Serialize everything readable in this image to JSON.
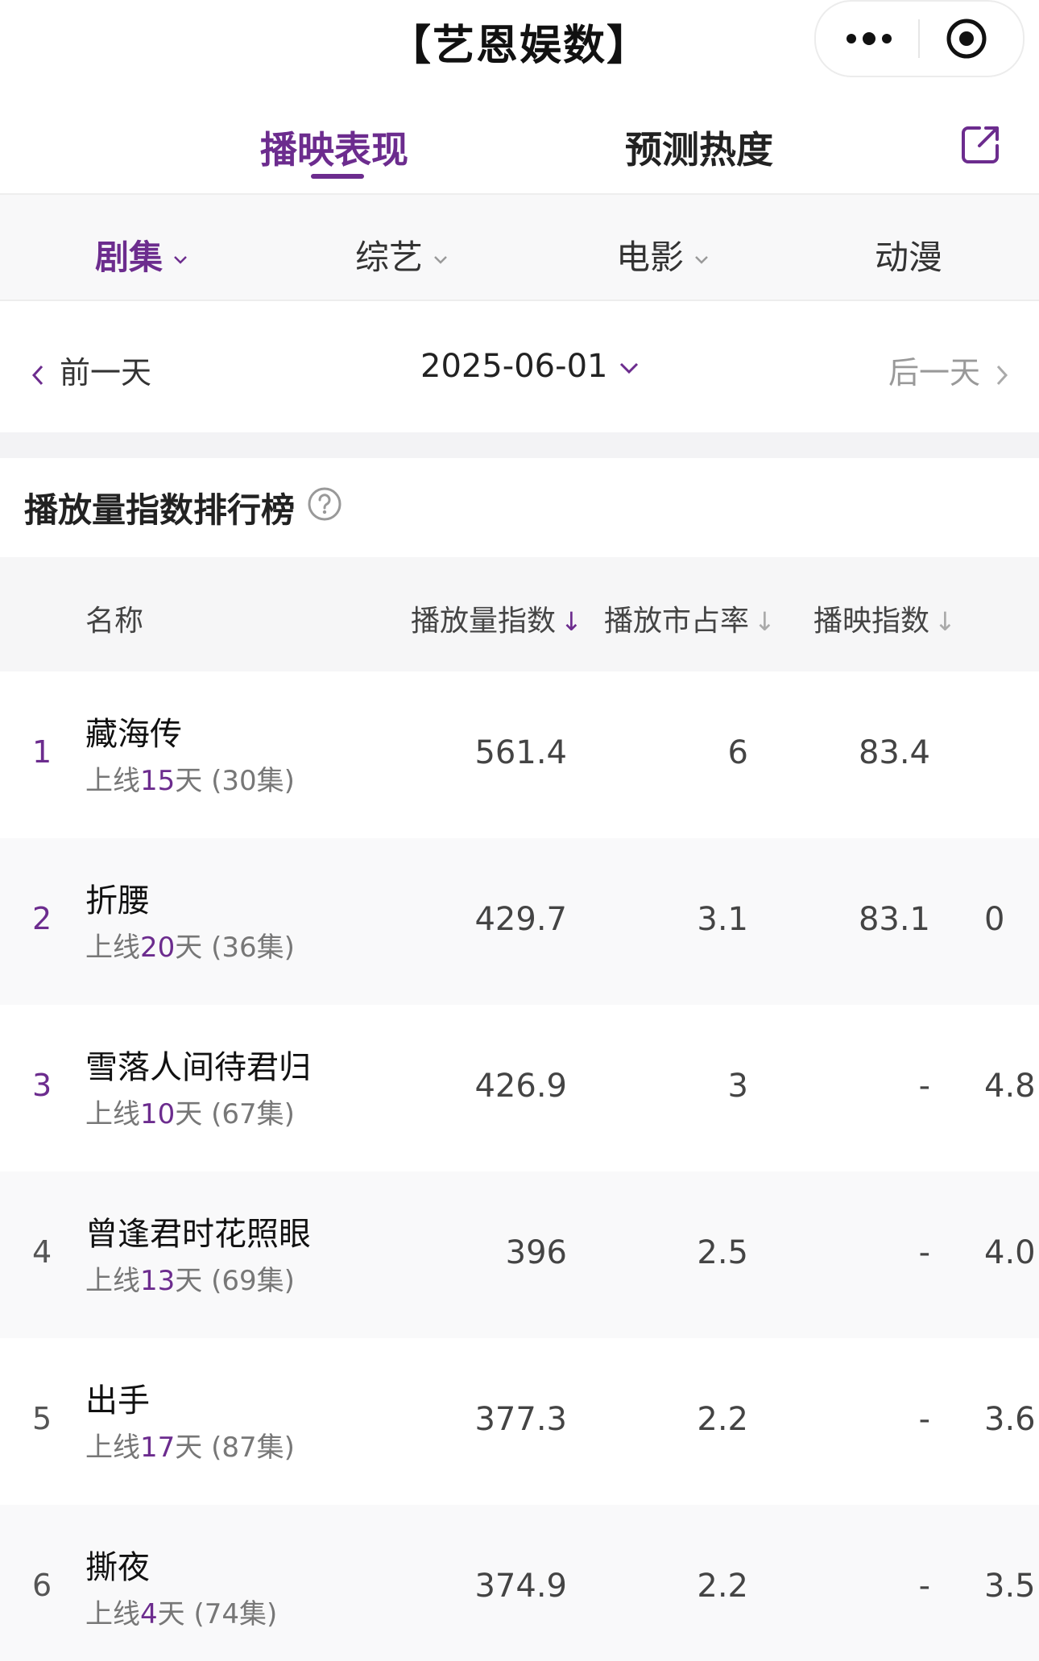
{
  "app_title": "【艺恩娱数】",
  "main_tabs": [
    {
      "label": "播映表现",
      "active": true
    },
    {
      "label": "预测热度",
      "active": false
    }
  ],
  "categories": [
    {
      "label": "剧集",
      "active": true,
      "has_dropdown": true
    },
    {
      "label": "综艺",
      "active": false,
      "has_dropdown": true
    },
    {
      "label": "电影",
      "active": false,
      "has_dropdown": true
    },
    {
      "label": "动漫",
      "active": false,
      "has_dropdown": false
    }
  ],
  "date_nav": {
    "prev_label": "前一天",
    "current_date": "2025-06-01",
    "next_label": "后一天"
  },
  "ranking": {
    "title": "播放量指数排行榜",
    "columns": [
      "名称",
      "播放量指数",
      "播放市占率",
      "播映指数"
    ],
    "rows": [
      {
        "rank": "1",
        "name": "藏海传",
        "sub_prefix": "上线",
        "days": "15",
        "sub_suffix": "天 (30集)",
        "play_index": "561.4",
        "market_share": "6",
        "broadcast_index": "83.4",
        "extra": ""
      },
      {
        "rank": "2",
        "name": "折腰",
        "sub_prefix": "上线",
        "days": "20",
        "sub_suffix": "天 (36集)",
        "play_index": "429.7",
        "market_share": "3.1",
        "broadcast_index": "83.1",
        "extra": "0"
      },
      {
        "rank": "3",
        "name": "雪落人间待君归",
        "sub_prefix": "上线",
        "days": "10",
        "sub_suffix": "天 (67集)",
        "play_index": "426.9",
        "market_share": "3",
        "broadcast_index": "-",
        "extra": "4.8"
      },
      {
        "rank": "4",
        "name": "曾逢君时花照眼",
        "sub_prefix": "上线",
        "days": "13",
        "sub_suffix": "天 (69集)",
        "play_index": "396",
        "market_share": "2.5",
        "broadcast_index": "-",
        "extra": "4.0"
      },
      {
        "rank": "5",
        "name": "出手",
        "sub_prefix": "上线",
        "days": "17",
        "sub_suffix": "天 (87集)",
        "play_index": "377.3",
        "market_share": "2.2",
        "broadcast_index": "-",
        "extra": "3.6"
      },
      {
        "rank": "6",
        "name": "撕夜",
        "sub_prefix": "上线",
        "days": "4",
        "sub_suffix": "天 (74集)",
        "play_index": "374.9",
        "market_share": "2.2",
        "broadcast_index": "-",
        "extra": "3.5"
      }
    ]
  },
  "colors": {
    "accent": "#6c2c8e",
    "header_bg": "#f6f6f7"
  }
}
